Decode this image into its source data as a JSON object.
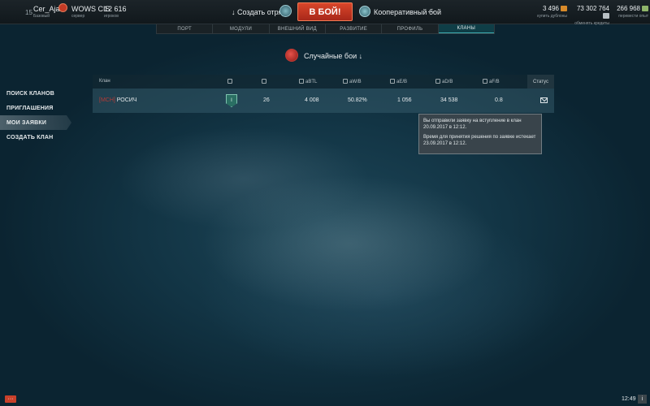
{
  "topbar": {
    "level": "15",
    "player_name": "Cer_Ajani",
    "player_status": "Базовый",
    "server_name": "WOWS CIS",
    "server_label": "сервер",
    "online_count": "12 616",
    "online_label": "игроков",
    "division_label": "Создать отряд",
    "battle_button": "В БОЙ!",
    "mode_label": "Кооперативный бой",
    "mode_more": "···",
    "doubloons": "3 496",
    "doubloons_label": "купить дублоны",
    "credits": "73 302 764",
    "credits_label": "обменять кредиты",
    "free_xp": "266 968",
    "free_xp_label": "перевести опыт"
  },
  "tabs": [
    "ПОРТ",
    "МОДУЛИ",
    "ВНЕШНИЙ ВИД",
    "РАЗВИТИЕ",
    "ПРОФИЛЬ",
    "КЛАНЫ"
  ],
  "battle_type": "Случайные бои ↓",
  "sidebar": [
    "ПОИСК КЛАНОВ",
    "ПРИГЛАШЕНИЯ",
    "МОИ ЗАЯВКИ",
    "СОЗДАТЬ КЛАН"
  ],
  "table": {
    "headers": {
      "clan": "Клан",
      "abtl": "aBTL",
      "awb": "aW/B",
      "aeb": "aE/B",
      "adb": "aD/B",
      "afb": "aF/B",
      "status": "Статус"
    },
    "row": {
      "clan_tag": "[МСН]",
      "clan_name": "РОСИЧ",
      "league": "I",
      "members": "26",
      "abtl": "4 008",
      "awb": "50.82%",
      "aeb": "1 056",
      "adb": "34 538",
      "afb": "0.8"
    }
  },
  "tooltip": {
    "line1": "Вы отправили заявку на вступление в клан 20.09.2017 в 12:12.",
    "line2": "Время для принятия решения по заявке истекает 23.09.2017 в 12:12."
  },
  "bottom": {
    "chat": "···",
    "time": "12:49",
    "info": "i"
  },
  "colors": {
    "accent_red": "#c9402a",
    "clan_tag": "#b43a36",
    "active_tab": "#3fb3b8"
  }
}
